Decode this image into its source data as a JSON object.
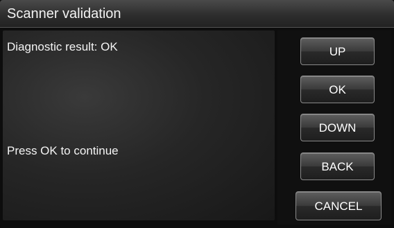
{
  "header": {
    "title": "Scanner validation"
  },
  "content": {
    "result_text": "Diagnostic result: OK",
    "prompt_text": "Press OK to continue"
  },
  "buttons": {
    "up": "UP",
    "ok": "OK",
    "down": "DOWN",
    "back": "BACK",
    "cancel": "CANCEL"
  }
}
